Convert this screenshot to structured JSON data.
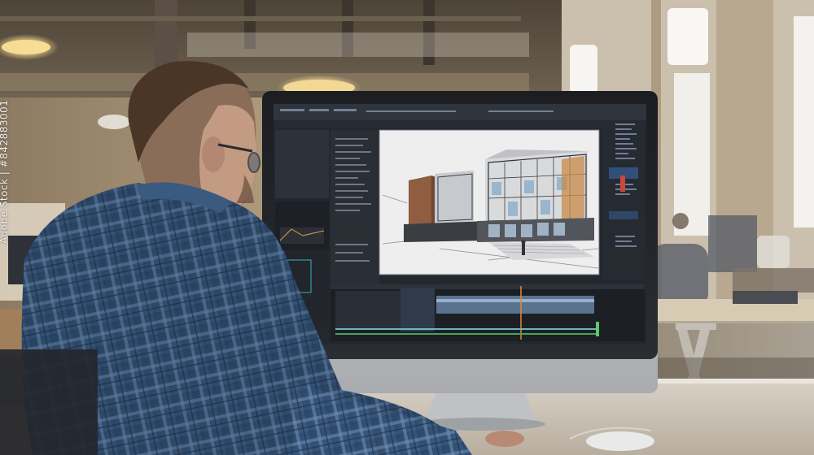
{
  "photo": {
    "subject": "man-at-workstation",
    "screen_content": "architectural-3d-model-software"
  },
  "watermark": {
    "text": "Adobe Stock | #842883001"
  },
  "colors": {
    "wall": "#a99478",
    "screen_bg": "#2a2f37",
    "canvas_bg": "#e9e9ea",
    "shirt": "#2e4a6b",
    "desk": "#c9c2b6"
  }
}
